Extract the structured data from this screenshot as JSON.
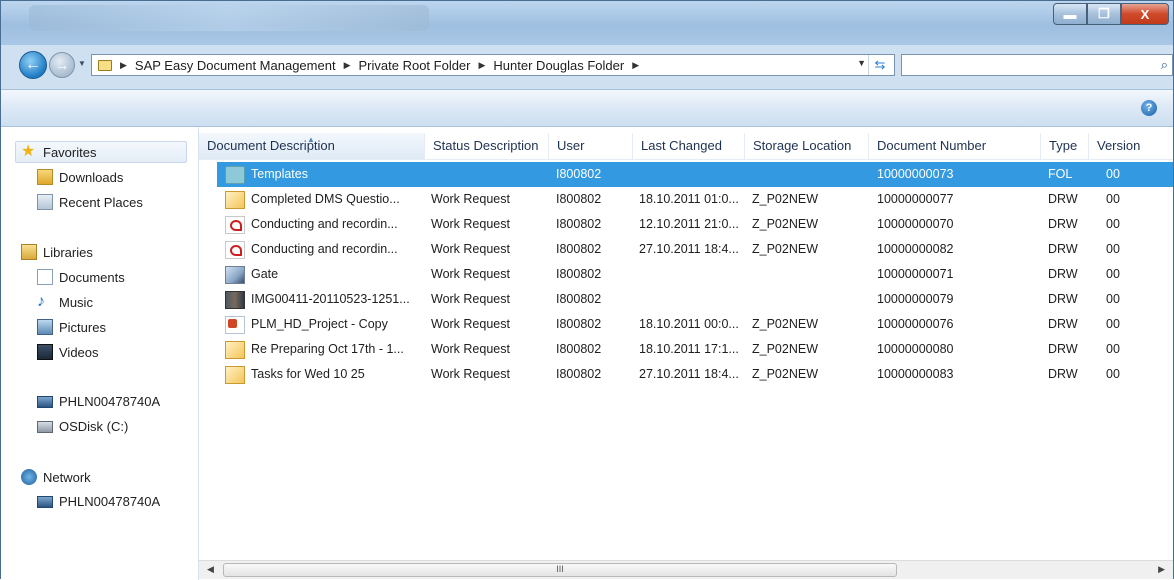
{
  "window": {
    "controls": {
      "minimize": "▬",
      "maximize": "❐",
      "close": "X"
    }
  },
  "nav": {
    "back_icon": "←",
    "forward_icon": "→",
    "address": {
      "crumbs": [
        "SAP Easy Document Management",
        "Private Root Folder",
        "Hunter Douglas Folder"
      ]
    },
    "search_placeholder": ""
  },
  "toolbar": {
    "help_label": "?"
  },
  "sidebar": {
    "favorites": {
      "label": "Favorites",
      "items": [
        "Downloads",
        "Recent Places"
      ]
    },
    "libraries": {
      "label": "Libraries",
      "items": [
        "Documents",
        "Music",
        "Pictures",
        "Videos"
      ]
    },
    "computer": {
      "label": "PHLN00478740A",
      "items": [
        "OSDisk (C:)"
      ]
    },
    "network": {
      "label": "Network",
      "items": [
        "PHLN00478740A"
      ]
    }
  },
  "table": {
    "columns": [
      "Document Description",
      "Status Description",
      "User",
      "Last Changed",
      "Storage Location",
      "Document Number",
      "Type",
      "Version"
    ],
    "rows": [
      {
        "icon": "folder-icon",
        "description": "Templates",
        "status": "",
        "user": "I800802",
        "changed": "",
        "location": "",
        "number": "10000000073",
        "type": "FOL",
        "version": "00",
        "selected": true
      },
      {
        "icon": "mail-icon",
        "description": "Completed DMS Questio...",
        "status": "Work Request",
        "user": "I800802",
        "changed": "18.10.2011 01:0...",
        "location": "Z_P02NEW",
        "number": "10000000077",
        "type": "DRW",
        "version": "00"
      },
      {
        "icon": "pdf-icon",
        "description": "Conducting and recordin...",
        "status": "Work Request",
        "user": "I800802",
        "changed": "12.10.2011 21:0...",
        "location": "Z_P02NEW",
        "number": "10000000070",
        "type": "DRW",
        "version": "00"
      },
      {
        "icon": "pdf-icon",
        "description": "Conducting and recordin...",
        "status": "Work Request",
        "user": "I800802",
        "changed": "27.10.2011 18:4...",
        "location": "Z_P02NEW",
        "number": "10000000082",
        "type": "DRW",
        "version": "00"
      },
      {
        "icon": "image-icon",
        "description": "Gate",
        "status": "Work Request",
        "user": "I800802",
        "changed": "",
        "location": "",
        "number": "10000000071",
        "type": "DRW",
        "version": "00"
      },
      {
        "icon": "photo-icon",
        "description": "IMG00411-20110523-1251...",
        "status": "Work Request",
        "user": "I800802",
        "changed": "",
        "location": "",
        "number": "10000000079",
        "type": "DRW",
        "version": "00"
      },
      {
        "icon": "powerpoint-icon",
        "description": "PLM_HD_Project - Copy",
        "status": "Work Request",
        "user": "I800802",
        "changed": "18.10.2011 00:0...",
        "location": "Z_P02NEW",
        "number": "10000000076",
        "type": "DRW",
        "version": "00"
      },
      {
        "icon": "mail-icon",
        "description": "Re Preparing Oct 17th - 1...",
        "status": "Work Request",
        "user": "I800802",
        "changed": "18.10.2011 17:1...",
        "location": "Z_P02NEW",
        "number": "10000000080",
        "type": "DRW",
        "version": "00"
      },
      {
        "icon": "mail-icon",
        "description": "Tasks for Wed 10 25",
        "status": "Work Request",
        "user": "I800802",
        "changed": "27.10.2011 18:4...",
        "location": "Z_P02NEW",
        "number": "10000000083",
        "type": "DRW",
        "version": "00"
      }
    ]
  },
  "scrollbar": {
    "grip": "III",
    "left_arrow": "◀",
    "right_arrow": "▶"
  },
  "colors": {
    "selection": "#3399e0",
    "titlebar": "#a9c7e6"
  }
}
